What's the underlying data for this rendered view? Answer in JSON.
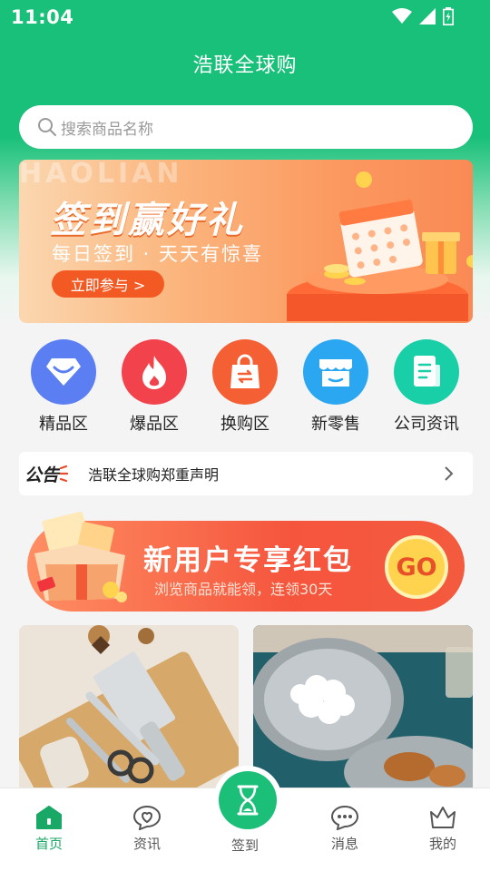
{
  "status_bar": {
    "time": "11:04"
  },
  "app_title": "浩联全球购",
  "search": {
    "placeholder": "搜索商品名称"
  },
  "banner": {
    "watermark": "HAOLIAN",
    "title": "签到赢好礼",
    "subtitle": "每日签到 · 天天有惊喜",
    "button": "立即参与 >"
  },
  "categories": [
    {
      "label": "精品区",
      "icon": "diamond-icon",
      "color": "#5b7ff2"
    },
    {
      "label": "爆品区",
      "icon": "flame-icon",
      "color": "#f2434c"
    },
    {
      "label": "换购区",
      "icon": "exchange-bag-icon",
      "color": "#f46033"
    },
    {
      "label": "新零售",
      "icon": "store-icon",
      "color": "#2aa7f0"
    },
    {
      "label": "公司资讯",
      "icon": "document-icon",
      "color": "#18cfa7"
    }
  ],
  "notice": {
    "badge": "公告",
    "text": "浩联全球购郑重声明"
  },
  "promo": {
    "title": "新用户专享红包",
    "subtitle": "浏览商品就能领，连领30天",
    "go": "GO"
  },
  "tabs": [
    {
      "label": "首页",
      "icon": "home-icon",
      "active": true
    },
    {
      "label": "资讯",
      "icon": "heart-chat-icon",
      "active": false
    },
    {
      "label": "签到",
      "icon": "hourglass-icon",
      "active": false
    },
    {
      "label": "消息",
      "icon": "message-icon",
      "active": false
    },
    {
      "label": "我的",
      "icon": "crown-icon",
      "active": false
    }
  ],
  "colors": {
    "brand": "#19c07a",
    "active_tab": "#19a866"
  }
}
